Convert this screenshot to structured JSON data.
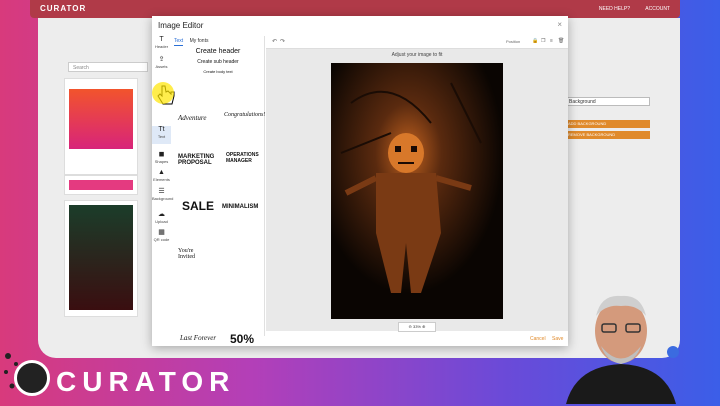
{
  "app": {
    "brand": "CURATOR",
    "help": "NEED HELP?",
    "account": "ACCOUNT"
  },
  "background_app": {
    "search_placeholder": "Search",
    "select_value": "Background",
    "buttons": [
      "ADD BACKGROUND",
      "REMOVE BACKGROUND"
    ]
  },
  "modal": {
    "title": "Image Editor",
    "rail": [
      {
        "label": "Header",
        "icon": "text-icon"
      },
      {
        "label": "Assets",
        "icon": "upload-icon"
      },
      {
        "label": "Text",
        "icon": "text-icon"
      },
      {
        "label": "Shapes",
        "icon": "shapes-icon"
      },
      {
        "label": "Elements",
        "icon": "elements-icon"
      },
      {
        "label": "Background",
        "icon": "background-icon"
      },
      {
        "label": "Upload",
        "icon": "cloud-upload-icon"
      },
      {
        "label": "QR code",
        "icon": "qr-code-icon"
      }
    ],
    "tabs": [
      "Text",
      "My fonts"
    ],
    "presets": [
      "Create header",
      "Create sub header",
      "Create body text"
    ],
    "templates": [
      "Adventure",
      "Congratulations!",
      "MARKETING PROPOSAL",
      "OPERATIONS MANAGER",
      "SALE",
      "MINIMALISM",
      "You're Invited",
      "Last Forever",
      "50%"
    ],
    "toolbar": {
      "position": "Position"
    },
    "hint": "Adjust your image to fit",
    "zoom": "33%",
    "cancel": "Cancel",
    "save": "Save"
  }
}
